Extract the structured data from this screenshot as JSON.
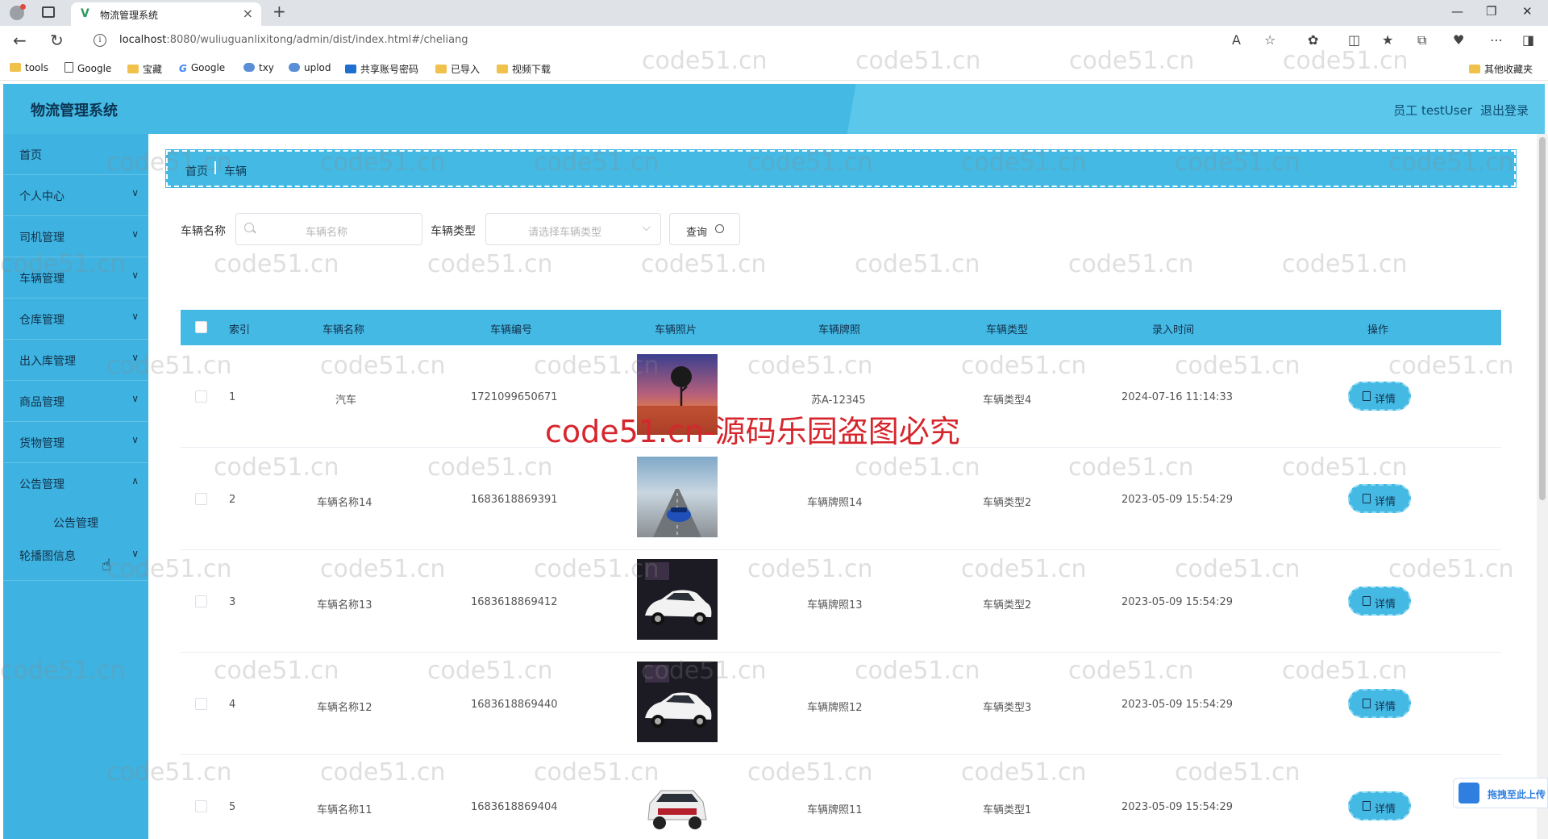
{
  "browser": {
    "tab_title": "物流管理系统",
    "tab_favicon": "V",
    "url_host": "localhost",
    "url_rest": ":8080/wuliuguanlixitong/admin/dist/index.html#/cheliang",
    "bookmarks": [
      "tools",
      "Google",
      "宝藏",
      "Google",
      "txy",
      "uplod",
      "共享账号密码",
      "已导入",
      "视频下载"
    ],
    "other_bookmarks": "其他收藏夹"
  },
  "app": {
    "title": "物流管理系统",
    "user": "员工 testUser",
    "logout": "退出登录",
    "accent": "#43b9e4"
  },
  "sidebar": {
    "items": [
      {
        "label": "首页"
      },
      {
        "label": "个人中心"
      },
      {
        "label": "司机管理"
      },
      {
        "label": "车辆管理"
      },
      {
        "label": "仓库管理"
      },
      {
        "label": "出入库管理"
      },
      {
        "label": "商品管理"
      },
      {
        "label": "货物管理"
      },
      {
        "label": "公告管理"
      },
      {
        "label": "轮播图信息"
      }
    ],
    "sub_item": "公告管理"
  },
  "breadcrumb": {
    "home": "首页",
    "current": "车辆"
  },
  "search": {
    "name_label": "车辆名称",
    "name_placeholder": "车辆名称",
    "type_label": "车辆类型",
    "type_placeholder": "请选择车辆类型",
    "query_label": "查询"
  },
  "table": {
    "headers": [
      "索引",
      "车辆名称",
      "车辆编号",
      "车辆照片",
      "车辆牌照",
      "车辆类型",
      "录入时间",
      "操作"
    ],
    "detail_label": "详情",
    "rows": [
      {
        "index": "1",
        "name": "汽车",
        "code": "1721099650671",
        "plate": "苏A-12345",
        "type": "车辆类型4",
        "time": "2024-07-16 11:14:33",
        "photo": "sunset-tree"
      },
      {
        "index": "2",
        "name": "车辆名称14",
        "code": "1683618869391",
        "plate": "车辆牌照14",
        "type": "车辆类型2",
        "time": "2023-05-09 15:54:29",
        "photo": "blue-car-road"
      },
      {
        "index": "3",
        "name": "车辆名称13",
        "code": "1683618869412",
        "plate": "车辆牌照13",
        "type": "车辆类型2",
        "time": "2023-05-09 15:54:29",
        "photo": "white-car-dark"
      },
      {
        "index": "4",
        "name": "车辆名称12",
        "code": "1683618869440",
        "plate": "车辆牌照12",
        "type": "车辆类型3",
        "time": "2023-05-09 15:54:29",
        "photo": "white-car-dark"
      },
      {
        "index": "5",
        "name": "车辆名称11",
        "code": "1683618869404",
        "plate": "车辆牌照11",
        "type": "车辆类型1",
        "time": "2023-05-09 15:54:29",
        "photo": "white-suv"
      }
    ]
  },
  "watermark": {
    "text": "code51.cn",
    "banner": "code51.cn-源码乐园盗图必究"
  },
  "widget": {
    "label": "拖拽至此上传"
  }
}
